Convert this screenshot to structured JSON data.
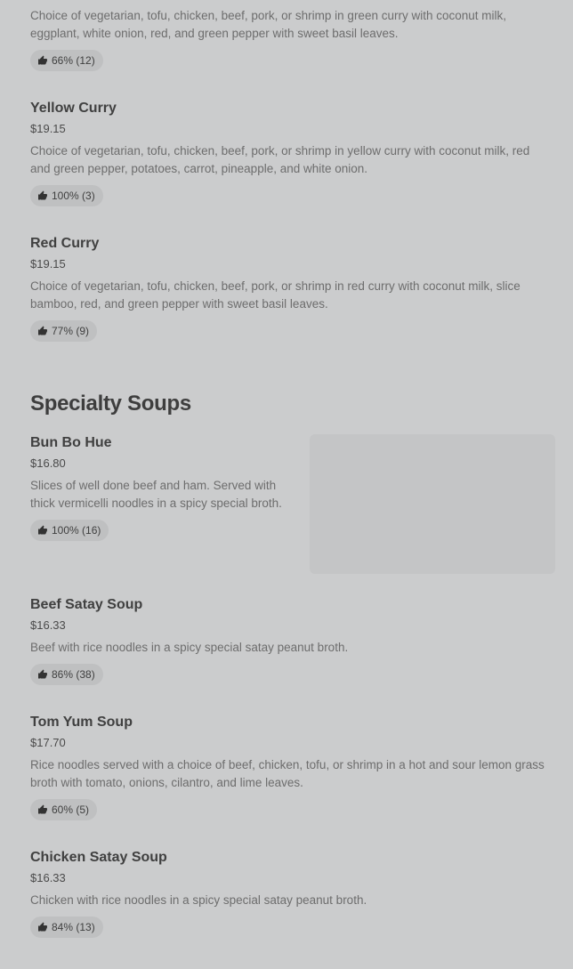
{
  "items_top": [
    {
      "name": "",
      "price": "",
      "description": "Choice of vegetarian, tofu, chicken, beef, pork, or shrimp in green curry with coconut milk, eggplant, white onion, red, and green pepper with sweet basil leaves.",
      "rating": "66% (12)"
    },
    {
      "name": "Yellow Curry",
      "price": "$19.15",
      "description": "Choice of vegetarian, tofu, chicken, beef, pork, or shrimp in yellow curry with coconut milk, red and green pepper, potatoes, carrot, pineapple, and white onion.",
      "rating": "100% (3)"
    },
    {
      "name": "Red Curry",
      "price": "$19.15",
      "description": "Choice of vegetarian, tofu, chicken, beef, pork, or shrimp in red curry with coconut milk, slice bamboo, red, and green pepper with sweet basil leaves.",
      "rating": "77% (9)"
    }
  ],
  "section": {
    "title": "Specialty Soups"
  },
  "items_soups": [
    {
      "name": "Bun Bo Hue",
      "price": "$16.80",
      "description": "Slices of well done beef and ham. Served with thick vermicelli noodles in a spicy special broth.",
      "rating": "100% (16)",
      "has_photo": true
    },
    {
      "name": "Beef Satay Soup",
      "price": "$16.33",
      "description": "Beef with rice noodles in a spicy special satay peanut broth.",
      "rating": "86% (38)"
    },
    {
      "name": "Tom Yum Soup",
      "price": "$17.70",
      "description": "Rice noodles served with a choice of beef, chicken, tofu, or shrimp in a hot and sour lemon grass broth with tomato, onions, cilantro, and lime leaves.",
      "rating": "60% (5)"
    },
    {
      "name": "Chicken Satay Soup",
      "price": "$16.33",
      "description": "Chicken with rice noodles in a spicy special satay peanut broth.",
      "rating": "84% (13)"
    }
  ],
  "icons": {
    "rating": "thumbs-up-icon"
  }
}
